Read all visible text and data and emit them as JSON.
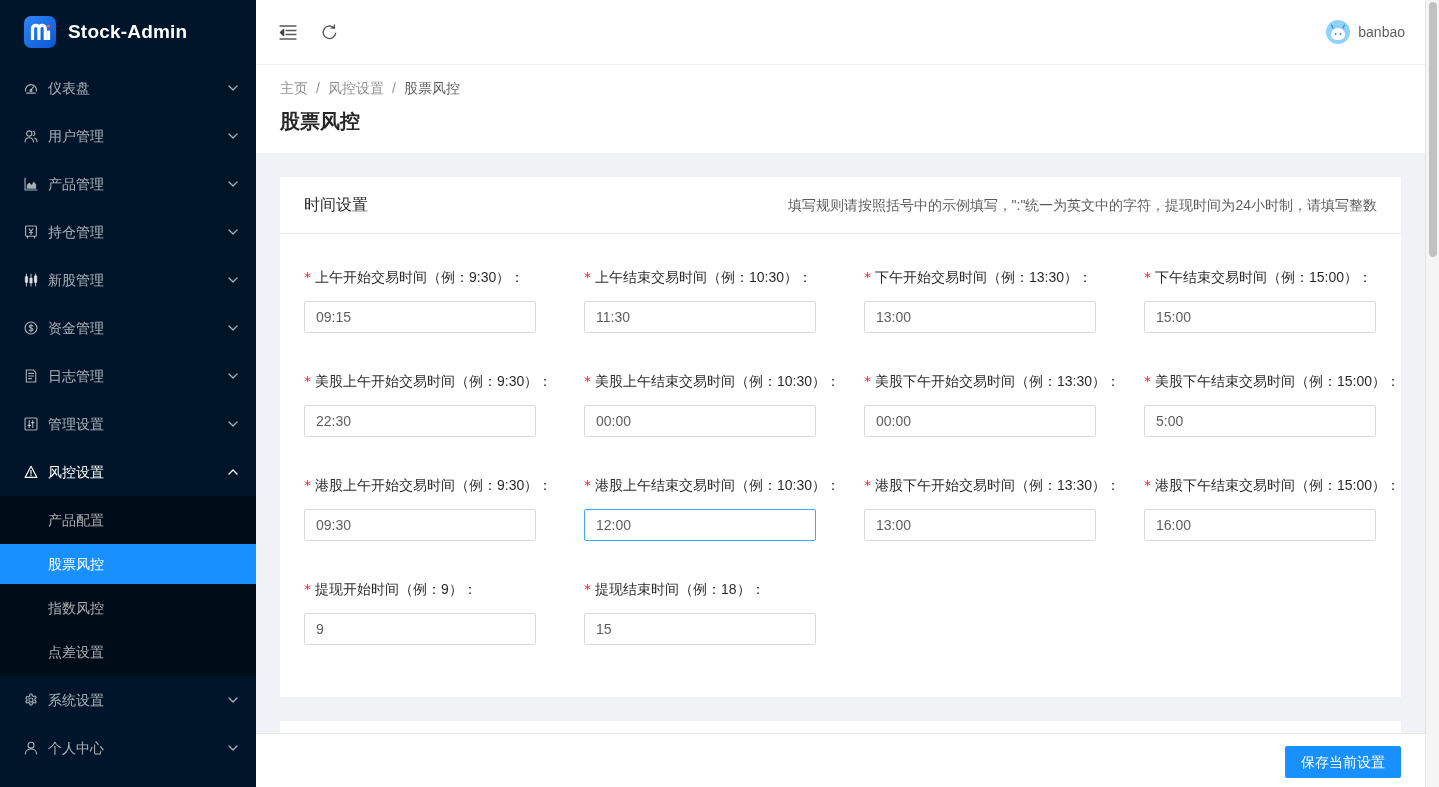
{
  "sidebar": {
    "app_name": "Stock-Admin",
    "items": [
      {
        "label": "仪表盘",
        "expanded": false
      },
      {
        "label": "用户管理",
        "expanded": false
      },
      {
        "label": "产品管理",
        "expanded": false
      },
      {
        "label": "持仓管理",
        "expanded": false
      },
      {
        "label": "新股管理",
        "expanded": false
      },
      {
        "label": "资金管理",
        "expanded": false
      },
      {
        "label": "日志管理",
        "expanded": false
      },
      {
        "label": "管理设置",
        "expanded": false
      },
      {
        "label": "风控设置",
        "expanded": true,
        "children": [
          {
            "label": "产品配置",
            "selected": false
          },
          {
            "label": "股票风控",
            "selected": true
          },
          {
            "label": "指数风控",
            "selected": false
          },
          {
            "label": "点差设置",
            "selected": false
          }
        ]
      },
      {
        "label": "系统设置",
        "expanded": false
      },
      {
        "label": "个人中心",
        "expanded": false
      }
    ]
  },
  "header": {
    "user_name": "banbao"
  },
  "breadcrumb": [
    {
      "kind": "link",
      "text": "主页"
    },
    {
      "kind": "separator",
      "text": "/"
    },
    {
      "kind": "link",
      "text": "风控设置"
    },
    {
      "kind": "separator",
      "text": "/"
    },
    {
      "kind": "current",
      "text": "股票风控"
    }
  ],
  "page_title": "股票风控",
  "card": {
    "title": "时间设置",
    "hint": "填写规则请按照括号中的示例填写，\":\"统一为英文中的字符，提现时间为24小时制，请填写整数",
    "fields": [
      {
        "required_mark": "*",
        "label": "上午开始交易时间（例：9:30）：",
        "value": "09:15",
        "focused": false
      },
      {
        "required_mark": "*",
        "label": "上午结束交易时间（例：10:30）：",
        "value": "11:30",
        "focused": false
      },
      {
        "required_mark": "*",
        "label": "下午开始交易时间（例：13:30）：",
        "value": "13:00",
        "focused": false
      },
      {
        "required_mark": "*",
        "label": "下午结束交易时间（例：15:00）：",
        "value": "15:00",
        "focused": false
      },
      {
        "required_mark": "*",
        "label": "美股上午开始交易时间（例：9:30）：",
        "value": "22:30",
        "focused": false
      },
      {
        "required_mark": "*",
        "label": "美股上午结束交易时间（例：10:30）：",
        "value": "00:00",
        "focused": false
      },
      {
        "required_mark": "*",
        "label": "美股下午开始交易时间（例：13:30）：",
        "value": "00:00",
        "focused": false
      },
      {
        "required_mark": "*",
        "label": "美股下午结束交易时间（例：15:00）：",
        "value": "5:00",
        "focused": false
      },
      {
        "required_mark": "*",
        "label": "港股上午开始交易时间（例：9:30）：",
        "value": "09:30",
        "focused": false
      },
      {
        "required_mark": "*",
        "label": "港股上午结束交易时间（例：10:30）：",
        "value": "12:00",
        "focused": true
      },
      {
        "required_mark": "*",
        "label": "港股下午开始交易时间（例：13:30）：",
        "value": "13:00",
        "focused": false
      },
      {
        "required_mark": "*",
        "label": "港股下午结束交易时间（例：15:00）：",
        "value": "16:00",
        "focused": false
      },
      {
        "required_mark": "*",
        "label": "提现开始时间（例：9）：",
        "value": "9",
        "focused": false
      },
      {
        "required_mark": "*",
        "label": "提现结束时间（例：18）：",
        "value": "15",
        "focused": false
      }
    ]
  },
  "footer": {
    "save_button": "保存当前设置"
  }
}
